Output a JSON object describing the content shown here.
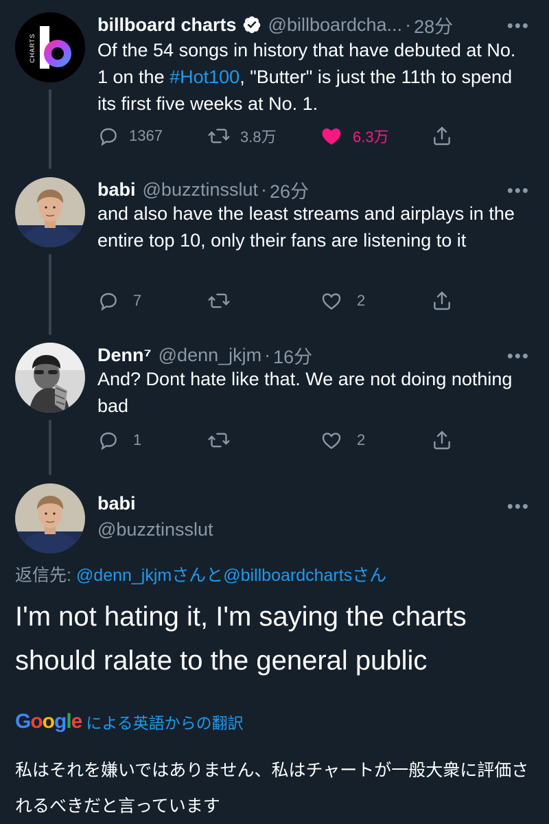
{
  "tweets": [
    {
      "name": "billboard charts",
      "handle": "@billboardcha...",
      "time": "28分",
      "verified": true,
      "text_parts": [
        "Of the 54 songs in history that have debuted at No. 1 on the ",
        "#Hot100",
        ", \"Butter\" is just the 11th to spend its first five weeks at No. 1."
      ],
      "reply_count": "1367",
      "retweet_count": "3.8万",
      "like_count": "6.3万",
      "liked": true
    },
    {
      "name": "babi",
      "handle": "@buzztinsslut",
      "time": "26分",
      "text": "and also have the least streams and airplays in the entire top 10, only their fans are listening to it",
      "reply_count": "7",
      "retweet_count": "",
      "like_count": "2"
    },
    {
      "name": "Denn⁷",
      "handle": "@denn_jkjm",
      "time": "16分",
      "text": "And? Dont hate like that. We are not doing nothing bad",
      "reply_count": "1",
      "retweet_count": "",
      "like_count": "2"
    }
  ],
  "focused": {
    "name": "babi",
    "handle": "@buzztinsslut",
    "reply_label": "返信先: ",
    "reply_users": "@denn_jkjmさんと@billboardchartsさん",
    "text": "I'm not hating it, I'm saying the charts should ralate to the general public",
    "translate_brand": "Google",
    "translate_label": "による英語からの翻訳",
    "translated_text": "私はそれを嫌いではありません、私はチャートが一般大衆に評価されるべきだと言っています"
  },
  "logo": {
    "letter": "b",
    "side_text": "CHARTS"
  },
  "colors": {
    "background": "#15202b",
    "accent": "#1d9bf0",
    "muted": "#8b98a5",
    "like": "#f91880"
  },
  "icons": [
    "reply-icon",
    "retweet-icon",
    "like-icon",
    "share-icon",
    "more-icon",
    "verified-icon"
  ]
}
